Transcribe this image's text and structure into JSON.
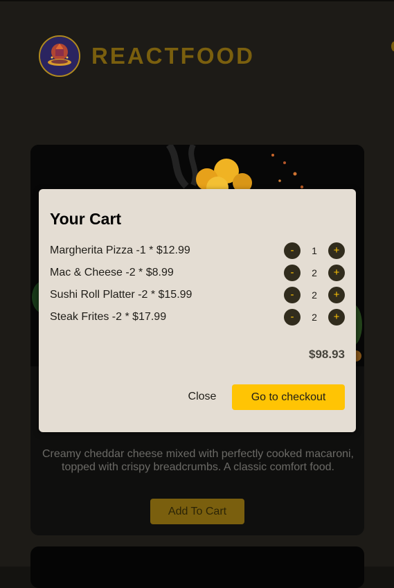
{
  "header": {
    "brand": "REACTFOOD"
  },
  "meal_card": {
    "description": "Creamy cheddar cheese mixed with perfectly cooked macaroni, topped with crispy breadcrumbs. A classic comfort food.",
    "add_to_cart_label": "Add To Cart"
  },
  "cart": {
    "title": "Your Cart",
    "items": [
      {
        "text": "Margherita Pizza -1 * $12.99",
        "quantity": "1"
      },
      {
        "text": "Mac & Cheese -2 * $8.99",
        "quantity": "2"
      },
      {
        "text": "Sushi Roll Platter -2 * $15.99",
        "quantity": "2"
      },
      {
        "text": "Steak Frites -2 * $17.99",
        "quantity": "2"
      }
    ],
    "decrement_label": "-",
    "increment_label": "+",
    "total": "$98.93",
    "close_label": "Close",
    "checkout_label": "Go to checkout"
  },
  "colors": {
    "accent": "#ffc404",
    "brand_text": "#7a5f0e",
    "modal_bg": "#e4ddd3",
    "qty_button_bg": "#312c1d"
  },
  "icons": {
    "logo": "food-logo-icon",
    "cart": "cart-icon"
  }
}
